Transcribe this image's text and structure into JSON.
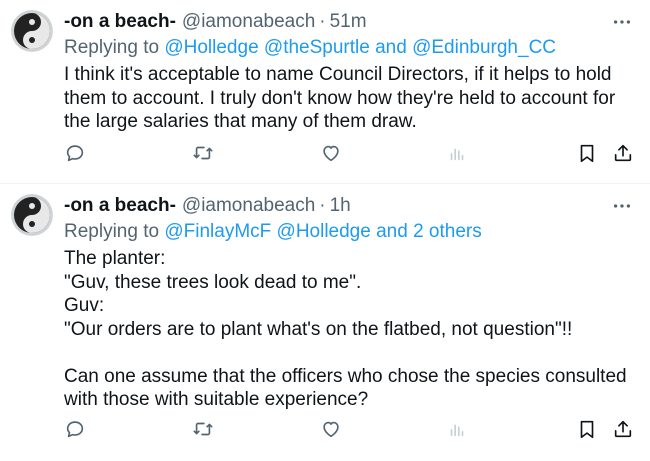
{
  "tweets": [
    {
      "name": "-on a beach-",
      "handle": "@iamonabeach",
      "separator": "·",
      "time": "51m",
      "reply_prefix": "Replying to",
      "mentions": [
        "@Holledge",
        "@theSpurtle",
        "and",
        "@Edinburgh_CC"
      ],
      "text": "I think it's acceptable to name Council Directors, if it helps to hold them to account. I truly don't know how they're held to account for the large salaries that many of them draw."
    },
    {
      "name": "-on a beach-",
      "handle": "@iamonabeach",
      "separator": "·",
      "time": "1h",
      "reply_prefix": "Replying to",
      "mentions": [
        "@FinlayMcF",
        "@Holledge",
        "and 2 others"
      ],
      "lines": [
        "The planter:",
        "\"Guv, these trees look dead to me\".",
        "Guv:",
        "\"Our orders are to plant what's on the flatbed, not question\"!!",
        "",
        "Can one assume that the officers who chose the species consulted with those with suitable experience?"
      ]
    }
  ],
  "icons": {
    "more": "more-horizontal-icon",
    "reply": "reply-icon",
    "retweet": "retweet-icon",
    "like": "heart-icon",
    "views": "analytics-icon",
    "bookmark": "bookmark-icon",
    "share": "share-icon"
  },
  "colors": {
    "text": "#0f1419",
    "secondary": "#536471",
    "link": "#1d9bf0",
    "divider": "#eff3f4"
  }
}
